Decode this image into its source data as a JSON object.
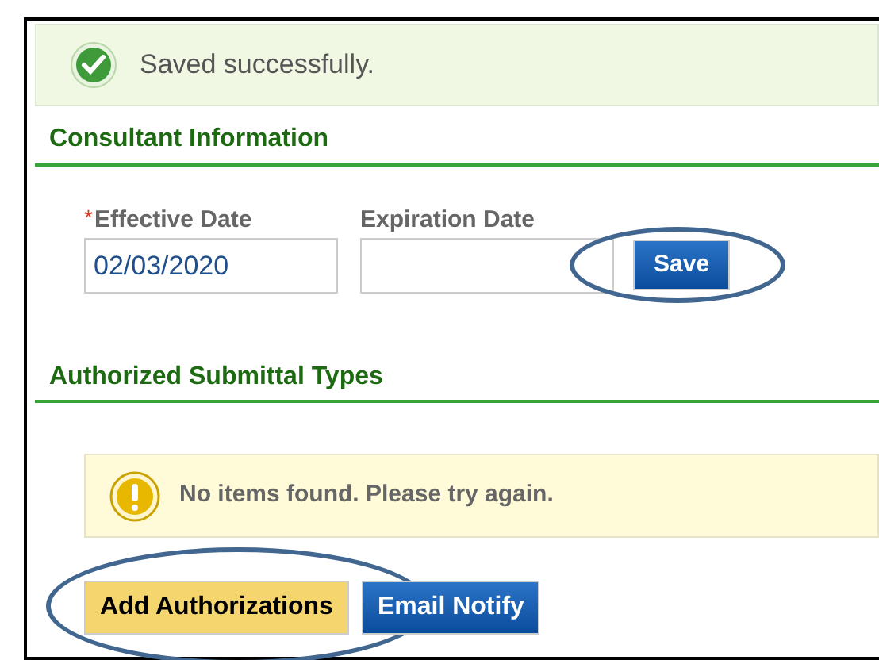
{
  "status_message": {
    "kind": "success",
    "text": "Saved successfully."
  },
  "consultant_information": {
    "heading": "Consultant Information",
    "fields": [
      {
        "required_mark": "*",
        "label": "Effective Date",
        "value": "02/03/2020"
      },
      {
        "label": "Expiration Date"
      }
    ],
    "save_button": {
      "label": "Save",
      "circled": true
    }
  },
  "authorized_submittal_types": {
    "heading": "Authorized Submittal Types",
    "message": {
      "kind": "warning",
      "text": "No items found. Please try again."
    },
    "buttons": [
      {
        "label": "Add Authorizations",
        "kind": "highlight",
        "circled": true
      },
      {
        "label": "Email Notify",
        "kind": "primary",
        "circled": false
      }
    ]
  }
}
